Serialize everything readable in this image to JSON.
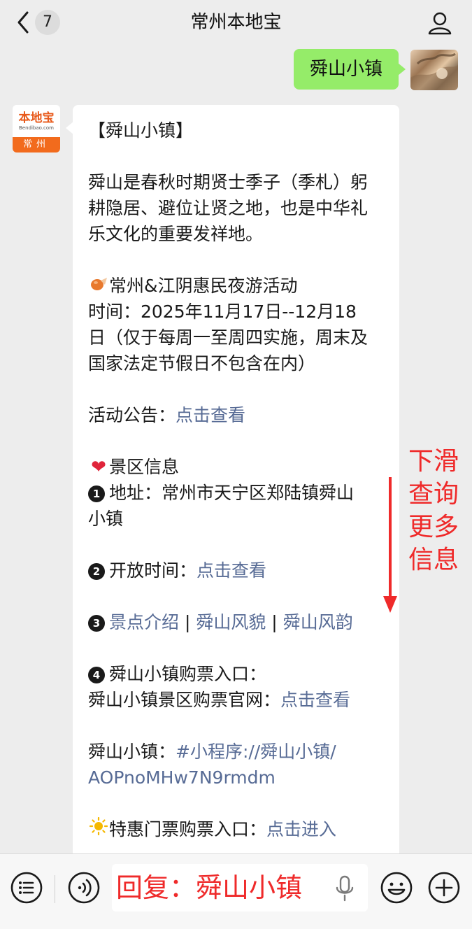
{
  "header": {
    "unread_count": "7",
    "title": "常州本地宝"
  },
  "my_message": {
    "text": "舜山小镇"
  },
  "avatar": {
    "brand": "本地宝",
    "domain": "Bendibao.com",
    "city": "常州"
  },
  "article": {
    "title": "【舜山小镇】",
    "intro_lines": [
      "舜山是春秋时期贤士季子（季札）躬",
      "耕隐居、避位让贤之地，也是中华礼",
      "乐文化的重要发祥地。"
    ],
    "event_title": "常州&江阴惠民夜游活动",
    "event_time_lines": [
      "时间：2025年11月17日--12月18",
      "日（仅于每周一至周四实施，周末及",
      "国家法定节假日不包含在内）"
    ],
    "notice_label": "活动公告：",
    "notice_link": "点击查看",
    "info_title": "景区信息",
    "address_label": "地址：常州市天宁区郑陆镇舜山",
    "address_line2": "小镇",
    "hours_label": "开放时间：",
    "hours_link": "点击查看",
    "links": [
      "景点介绍",
      "舜山风貌",
      "舜山风韵"
    ],
    "link_separator": " | ",
    "ticket_title": "舜山小镇购票入口：",
    "ticket_site_label": "舜山小镇景区购票官网：",
    "ticket_site_link": "点击查看",
    "miniprogram_label": "舜山小镇：",
    "miniprogram_link_1": "#小程序://舜山小镇/",
    "miniprogram_link_2": "AOPnoMHw7N9rmdm",
    "discount_label": "特惠门票购票入口：",
    "discount_link": "点击进入",
    "numbers": [
      "1",
      "2",
      "3",
      "4"
    ]
  },
  "overlay": {
    "scroll_hint_lines": [
      "下滑",
      "查询",
      "更多",
      "信息"
    ]
  },
  "input": {
    "text": "回复：舜山小镇"
  },
  "colors": {
    "accent_red": "#ef2a2a",
    "link": "#576b95",
    "my_bubble": "#95ec69",
    "brand_orange": "#f26b1d"
  }
}
